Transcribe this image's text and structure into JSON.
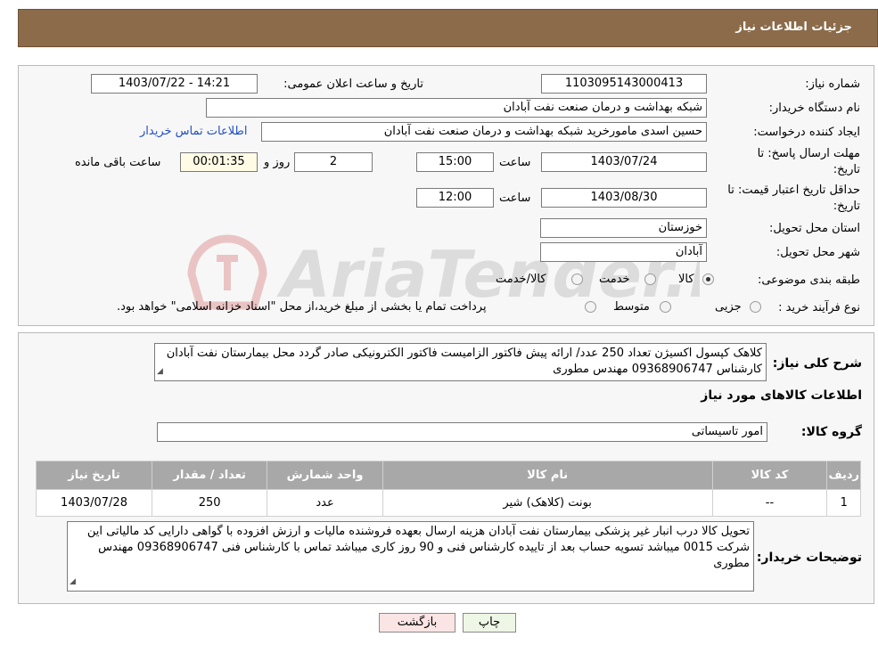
{
  "header": {
    "title": "جزئیات اطلاعات نیاز"
  },
  "labels": {
    "need_number": "شماره نیاز:",
    "announce_datetime": "تاریخ و ساعت اعلان عمومی:",
    "buyer_org": "نام دستگاه خریدار:",
    "requester": "ایجاد کننده درخواست:",
    "reply_deadline": "مهلت ارسال پاسخ: تا",
    "reply_deadline_2": "تاریخ:",
    "hour": "ساعت",
    "day_and": "روز و",
    "remaining": "ساعت باقی مانده",
    "price_validity": "حداقل تاریخ اعتبار قیمت: تا",
    "price_validity_2": "تاریخ:",
    "province": "استان محل تحویل:",
    "city": "شهر محل تحویل:",
    "category": "طبقه بندی موضوعی:",
    "purchase_type": "نوع فرآیند خرید :",
    "description": "شرح کلی نیاز:",
    "items_title": "اطلاعات کالاهای مورد نیاز",
    "goods_group": "گروه کالا:",
    "buyer_notes": "توضیحات خریدار:"
  },
  "values": {
    "need_number": "1103095143000413",
    "announce_datetime": "1403/07/22 - 14:21",
    "buyer_org": "شبکه بهداشت و درمان صنعت نفت آبادان",
    "requester": "حسین اسدی مامورخرید شبکه بهداشت و درمان صنعت نفت آبادان",
    "contact_link": "اطلاعات تماس خریدار",
    "reply_date": "1403/07/24",
    "reply_time": "15:00",
    "days": "2",
    "timer": "00:01:35",
    "validity_date": "1403/08/30",
    "validity_time": "12:00",
    "province": "خوزستان",
    "city": "آبادان",
    "cat_goods": "کالا",
    "cat_service": "خدمت",
    "cat_both": "کالا/خدمت",
    "pt_partial": "جزیی",
    "pt_medium": "متوسط",
    "pt_note": "پرداخت تمام یا بخشی از مبلغ خرید،از محل \"اسناد خزانه اسلامی\" خواهد بود.",
    "description": "کلاهک کپسول اکسیژن تعداد 250 عدد/ ارائه پیش فاکتور الزامیست فاکتور الکترونیکی صادر گردد محل بیمارستان نفت آبادان کارشناس 09368906747 مهندس مطوری",
    "goods_group": "امور تاسیساتی",
    "buyer_notes": "تحویل کالا درب انبار غیر پزشکی بیمارستان نفت آبادان هزینه ارسال بعهده فروشنده  مالیات و ارزش افزوده با گواهی دارایی کد مالیاتی این شرکت 0015 میباشد  تسویه حساب بعد از تاییده کارشناس فنی و 90 روز کاری میباشد تماس با کارشناس فنی 09368906747 مهندس مطوری"
  },
  "table": {
    "headers": [
      "ردیف",
      "کد کالا",
      "نام کالا",
      "واحد شمارش",
      "تعداد / مقدار",
      "تاریخ نیاز"
    ],
    "rows": [
      [
        "1",
        "--",
        "بونت (کلاهک) شیر",
        "عدد",
        "250",
        "1403/07/28"
      ]
    ]
  },
  "buttons": {
    "print": "چاپ",
    "back": "بازگشت"
  },
  "watermark": {
    "text": "AriaTender.neT"
  }
}
